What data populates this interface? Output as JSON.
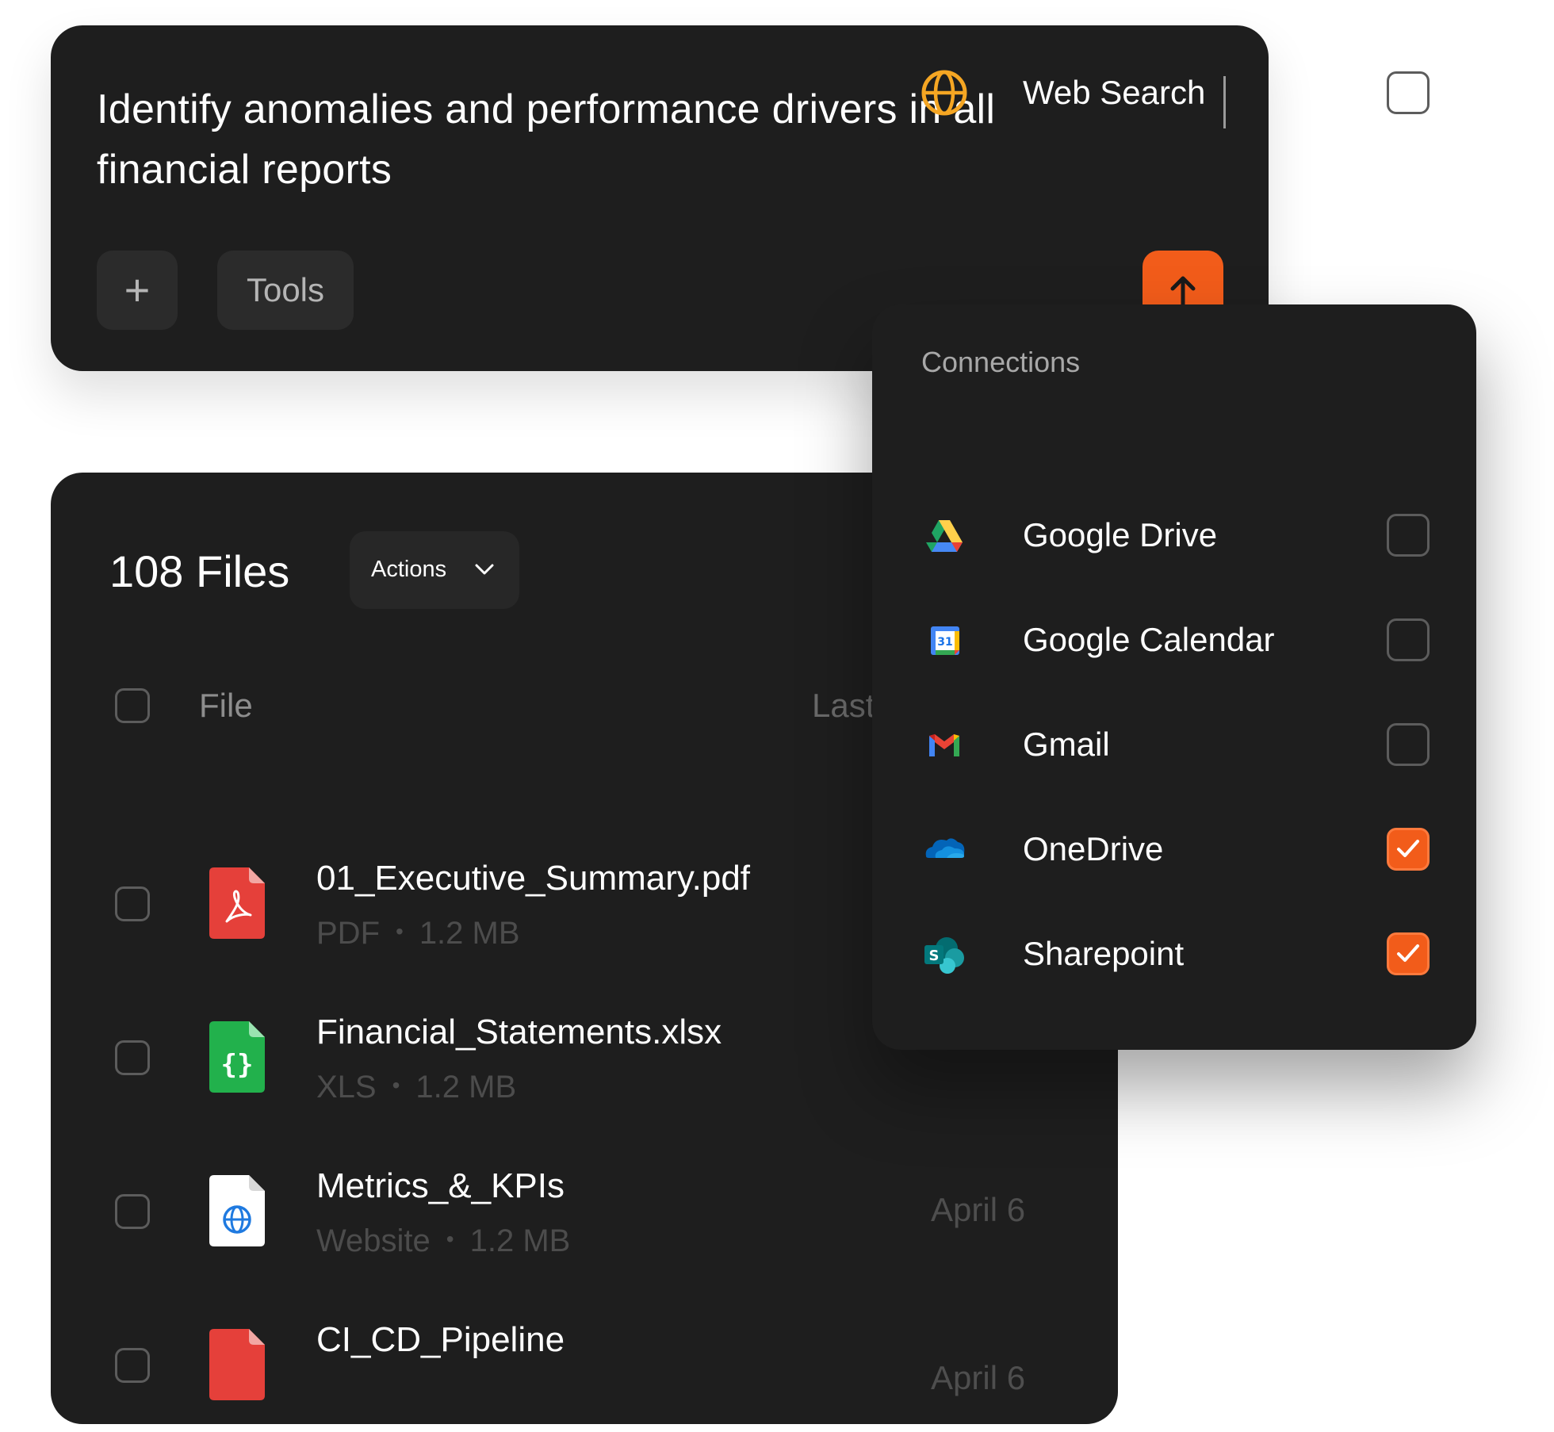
{
  "prompt": {
    "text": "Identify anomalies and performance drivers in all financial reports",
    "add_label": "+",
    "tools_label": "Tools"
  },
  "files": {
    "count_label": "108 Files",
    "actions_label": "Actions",
    "columns": {
      "file": "File",
      "last": "Last"
    },
    "rows": [
      {
        "name": "01_Executive_Summary.pdf",
        "type": "PDF",
        "size": "1.2 MB",
        "date": "",
        "icon": "pdf-icon"
      },
      {
        "name": "Financial_Statements.xlsx",
        "type": "XLS",
        "size": "1.2 MB",
        "date": "",
        "icon": "code-file-icon"
      },
      {
        "name": "Metrics_&_KPIs",
        "type": "Website",
        "size": "1.2 MB",
        "date": "April 6",
        "icon": "website-file-icon"
      },
      {
        "name": "CI_CD_Pipeline",
        "type": "",
        "size": "",
        "date": "April 6",
        "icon": "pdf-icon"
      }
    ]
  },
  "connections": {
    "title": "Connections",
    "items": [
      {
        "label": "Web Search",
        "checked": false,
        "icon": "globe-icon"
      },
      {
        "label": "Google Drive",
        "checked": false,
        "icon": "google-drive-icon"
      },
      {
        "label": "Google Calendar",
        "checked": false,
        "icon": "google-calendar-icon"
      },
      {
        "label": "Gmail",
        "checked": false,
        "icon": "gmail-icon"
      },
      {
        "label": "OneDrive",
        "checked": true,
        "icon": "onedrive-icon"
      },
      {
        "label": "Sharepoint",
        "checked": true,
        "icon": "sharepoint-icon"
      }
    ]
  },
  "colors": {
    "accent": "#f25c1a",
    "card_bg": "#1e1e1e",
    "button_bg": "#2b2b2b"
  }
}
